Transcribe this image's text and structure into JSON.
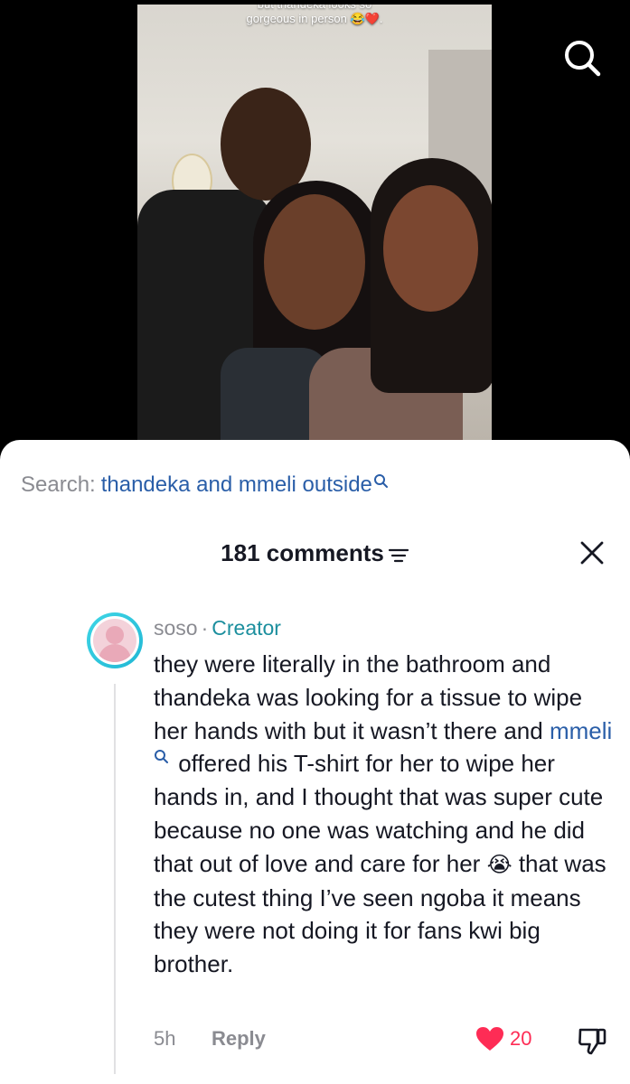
{
  "video": {
    "caption_line1": "but thandeka looks so",
    "caption_line2": "gorgeous in person 😂❤️.",
    "search_icon": "search-icon"
  },
  "search": {
    "label": "Search:",
    "query": "thandeka and mmeli outside"
  },
  "comments_header": {
    "count_label": "181 comments",
    "sort_icon": "sort-icon",
    "close_icon": "close-icon"
  },
  "comment": {
    "username": "soso",
    "separator": "·",
    "badge": "Creator",
    "text_before": "they were literally in the bathroom and thandeka was looking for a tissue to wipe her hands with but it wasn’t there and ",
    "mention": "mmeli",
    "text_middle": " offered his T-shirt for her to wipe her hands in, and I thought that was super cute because no one was watching and he did that out of love and care for her ",
    "emoji": "😭",
    "text_after": " that was the cutest thing I’ve seen ngoba it means they were not doing it for fans kwi big brother.",
    "time": "5h",
    "reply_label": "Reply",
    "like_count": "20",
    "liked": true
  },
  "colors": {
    "link_blue": "#2a5ea8",
    "creator_teal": "#1c8f9e",
    "like_red": "#fe2c55",
    "muted_gray": "#8a8b91",
    "text_dark": "#161823"
  }
}
